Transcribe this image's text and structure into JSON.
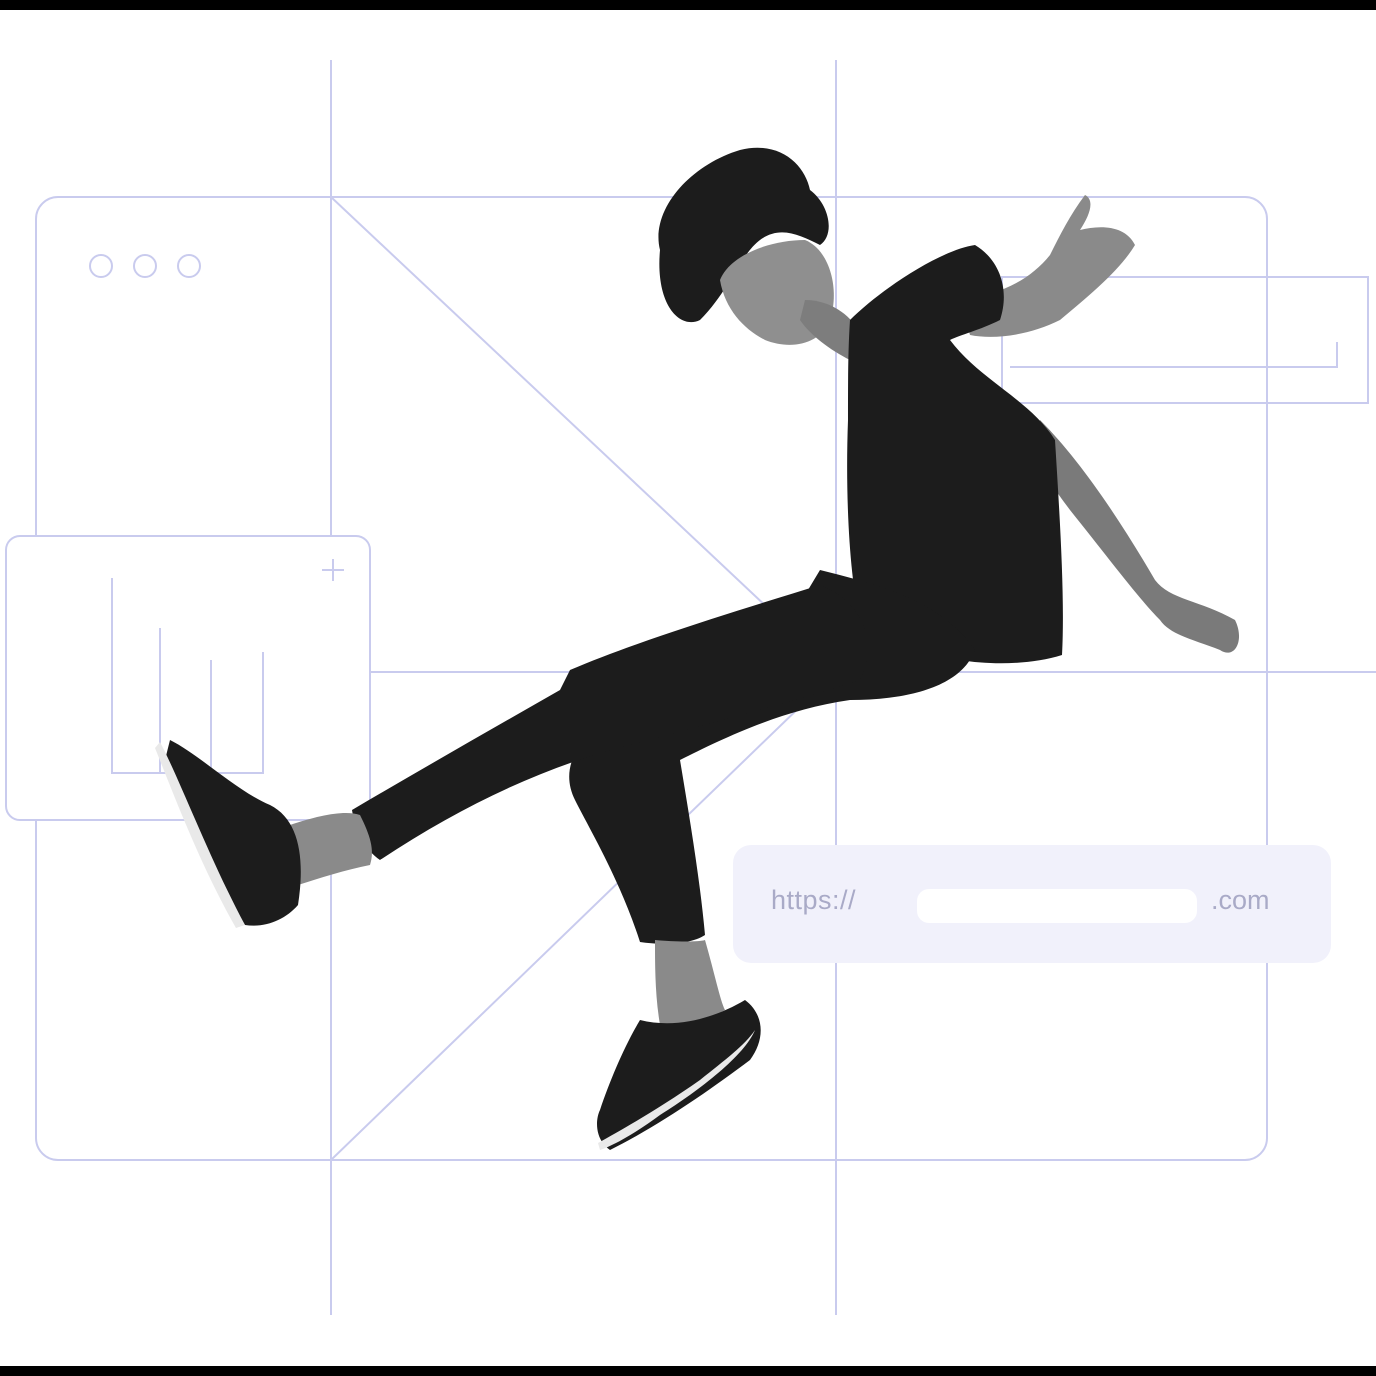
{
  "url_bar": {
    "prefix": "https://",
    "value": "",
    "suffix": ".com"
  },
  "widgets": {
    "window_dots_icon": "three-dots-icon",
    "add_icon": "plus-icon"
  },
  "person_photo": "person-jumping-image",
  "colors": {
    "line": "#c9cbee",
    "url_bar_bg": "#f1f1fb",
    "url_text": "#a9aac7",
    "ink": "#1a1a1a"
  }
}
